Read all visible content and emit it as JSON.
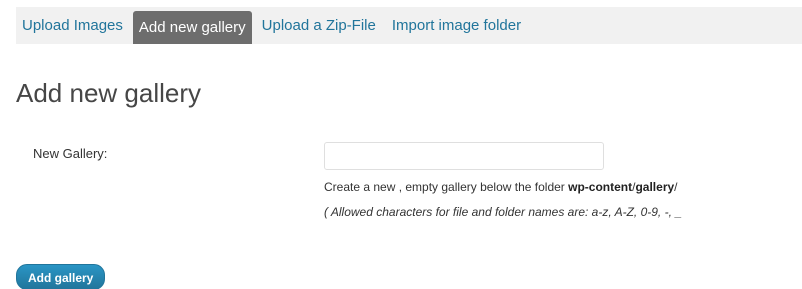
{
  "tabs": [
    {
      "label": "Upload Images",
      "active": false
    },
    {
      "label": "Add new gallery",
      "active": true
    },
    {
      "label": "Upload a Zip-File",
      "active": false
    },
    {
      "label": "Import image folder",
      "active": false
    }
  ],
  "heading": "Add new gallery",
  "form": {
    "label": "New Gallery:",
    "input_value": "",
    "description_prefix": "Create a new , empty gallery below the folder ",
    "path_part1": "wp-content",
    "path_sep": "/",
    "path_part2": "gallery",
    "path_end": "/",
    "hint": "( Allowed characters for file and folder names are: a-z, A-Z, 0-9, -, _"
  },
  "button": {
    "label": "Add gallery"
  },
  "colors": {
    "tab_link": "#21759b",
    "tab_active_bg": "#6d6d6d",
    "tabbar_bg": "#f1f1f1",
    "button_bg": "#21759b"
  }
}
